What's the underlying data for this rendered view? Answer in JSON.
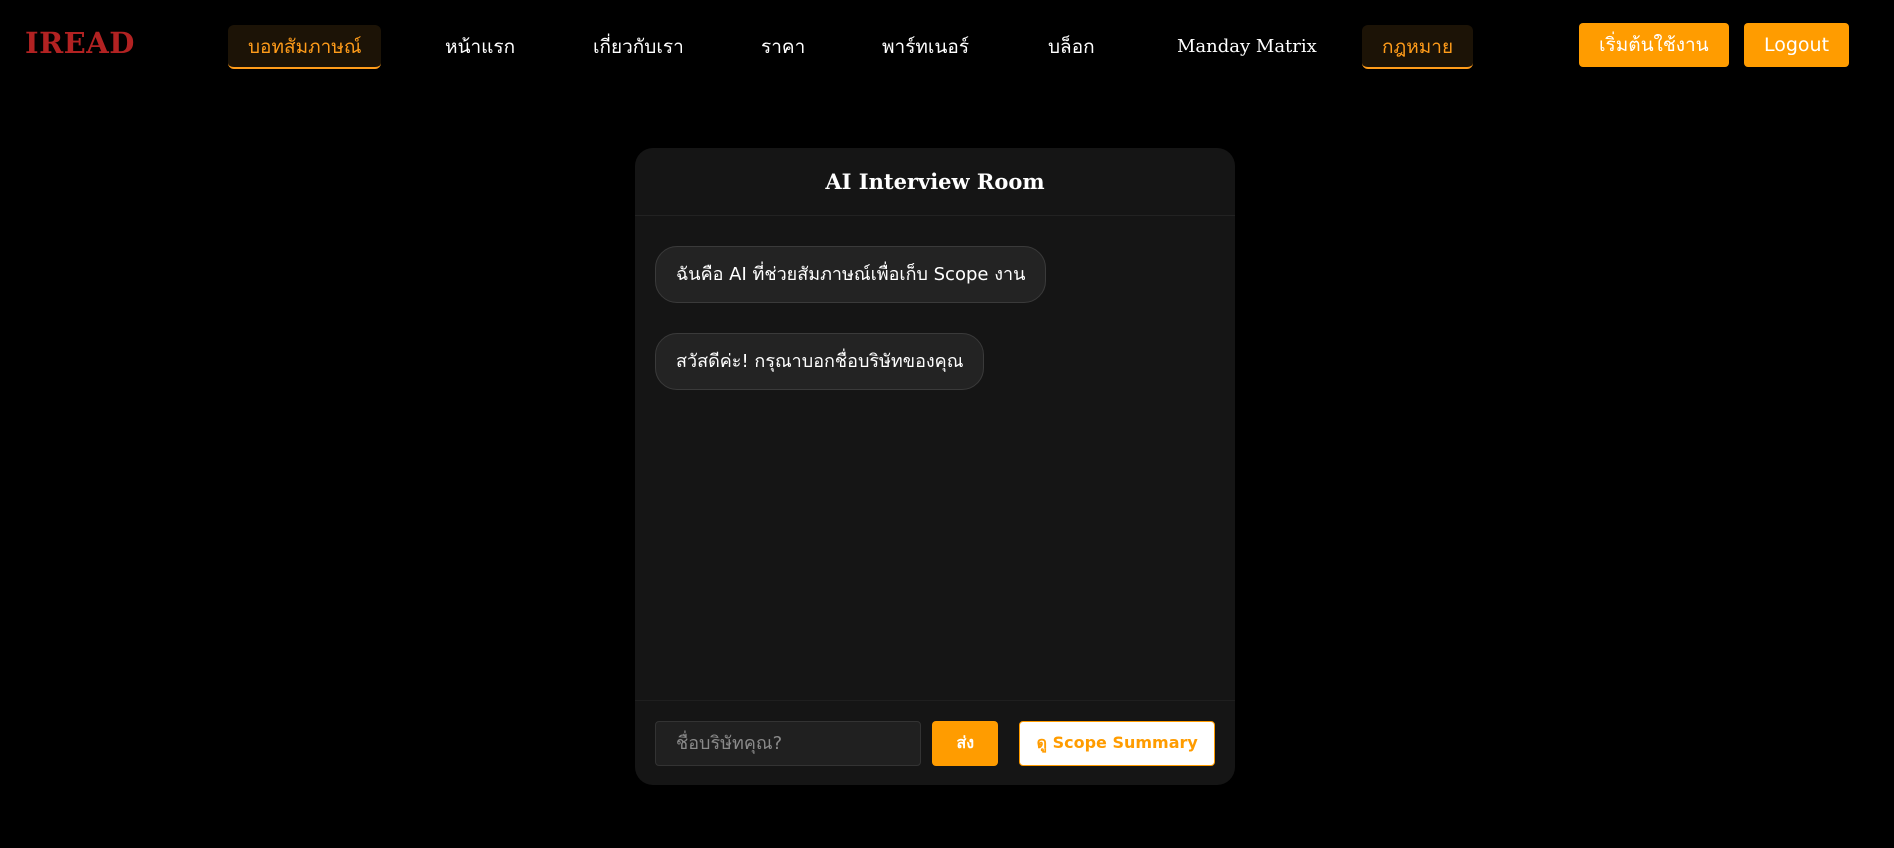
{
  "brand": {
    "logo": "IREAD",
    "logo_color": "#b22222"
  },
  "nav": {
    "items": [
      {
        "label": "บอทสัมภาษณ์",
        "active": true
      },
      {
        "label": "หน้าแรก"
      },
      {
        "label": "เกี่ยวกับเรา"
      },
      {
        "label": "ราคา"
      },
      {
        "label": "พาร์ทเนอร์"
      },
      {
        "label": "บล็อก"
      },
      {
        "label": "Manday Matrix"
      },
      {
        "label": "กฎหมาย",
        "active": true
      }
    ],
    "get_started": "เริ่มต้นใช้งาน",
    "logout": "Logout",
    "accent_color": "#ff9c00"
  },
  "chat": {
    "title": "AI Interview Room",
    "messages": [
      {
        "text": "ฉันคือ AI ที่ช่วยสัมภาษณ์เพื่อเก็บ Scope งาน"
      },
      {
        "text": "สวัสดีค่ะ! กรุณาบอกชื่อบริษัทของคุณ"
      }
    ],
    "input_placeholder": "ชื่อบริษัทคุณ?",
    "send_label": "ส่ง",
    "summary_label": "ดู Scope Summary"
  }
}
